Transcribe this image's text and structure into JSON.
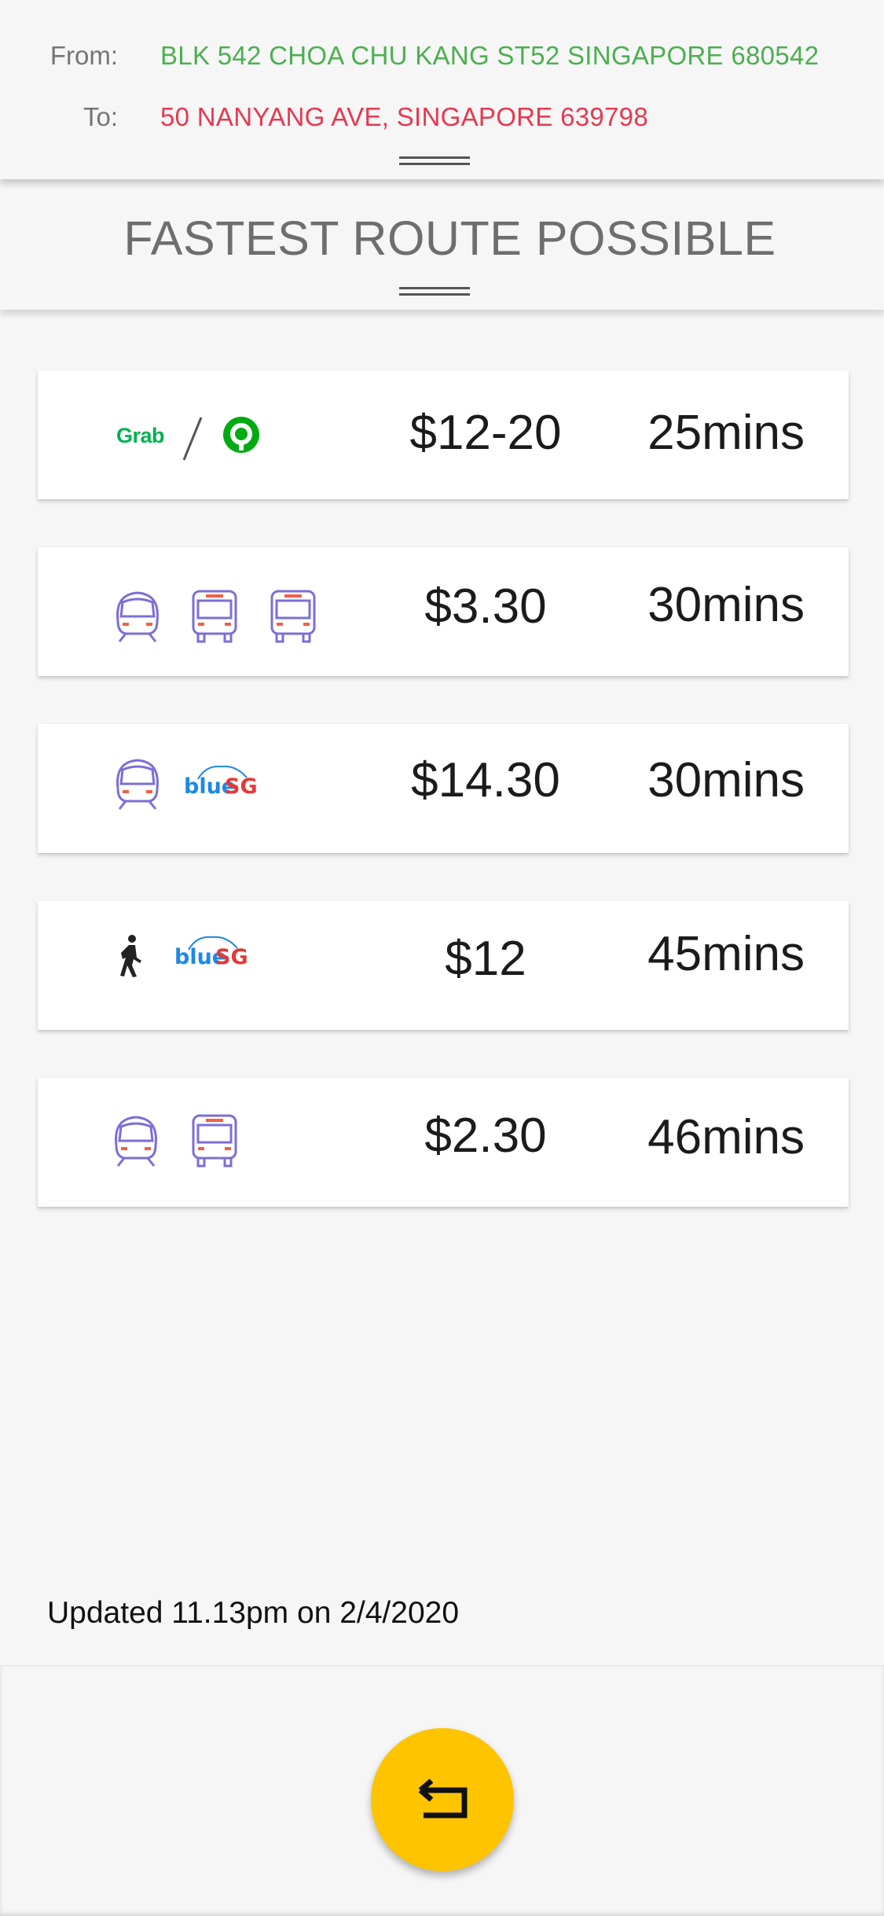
{
  "header": {
    "from_label": "From:",
    "from_value": "BLK 542 CHOA CHU KANG ST52 SINGAPORE 680542",
    "to_label": "To:",
    "to_value": "50 NANYANG AVE, SINGAPORE 639798"
  },
  "title": "FASTEST ROUTE POSSIBLE",
  "routes": [
    {
      "icons": [
        "grab-logo",
        "slash",
        "gojek-logo"
      ],
      "price": "$12-20",
      "duration": "25mins"
    },
    {
      "icons": [
        "train-icon",
        "bus-icon",
        "bus-icon"
      ],
      "price": "$3.30",
      "duration": "30mins"
    },
    {
      "icons": [
        "train-icon",
        "bluesg-logo"
      ],
      "price": "$14.30",
      "duration": "30mins"
    },
    {
      "icons": [
        "walking-icon",
        "bluesg-logo"
      ],
      "price": "$12",
      "duration": "45mins"
    },
    {
      "icons": [
        "train-icon",
        "bus-icon"
      ],
      "price": "$2.30",
      "duration": "46mins"
    }
  ],
  "logos": {
    "grab": "Grab",
    "bluesg_blue": "blue",
    "bluesg_sg": "SG"
  },
  "updated": "Updated 11.13pm on 2/4/2020",
  "colors": {
    "from": "#4caf50",
    "to": "#e53950",
    "fab": "#ffc400",
    "grab": "#00b14f",
    "gojek": "#00aa13",
    "transit_outline": "#7b6fd6",
    "transit_accent": "#f0604a",
    "bluesg_blue": "#1e88e5",
    "bluesg_red": "#e53935"
  }
}
